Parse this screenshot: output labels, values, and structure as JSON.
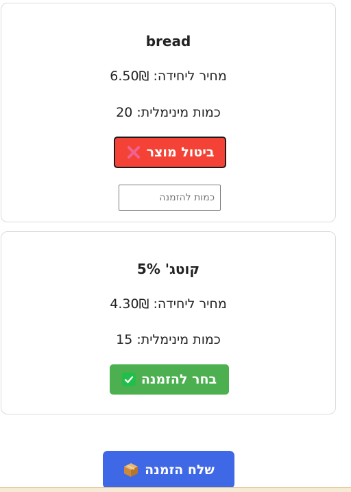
{
  "products": [
    {
      "name": "bread",
      "price_text": "מחיר ליחידה: 6.50₪",
      "min_qty_text": "כמות מינימלית: 20",
      "action_label": "ביטול מוצר",
      "action_icon": "x-icon",
      "state": "selected",
      "qty_placeholder": "כמות להזמנה"
    },
    {
      "name": "קוטג' 5%",
      "price_text": "מחיר ליחידה: 4.30₪",
      "min_qty_text": "כמות מינימלית: 15",
      "action_label": "בחר להזמנה",
      "action_icon": "check-icon",
      "state": "not-selected"
    }
  ],
  "submit": {
    "label": "שלח הזמנה",
    "icon": "package-icon"
  },
  "colors": {
    "cancel": "#f44336",
    "select": "#4caf50",
    "submit": "#3f68e6"
  }
}
